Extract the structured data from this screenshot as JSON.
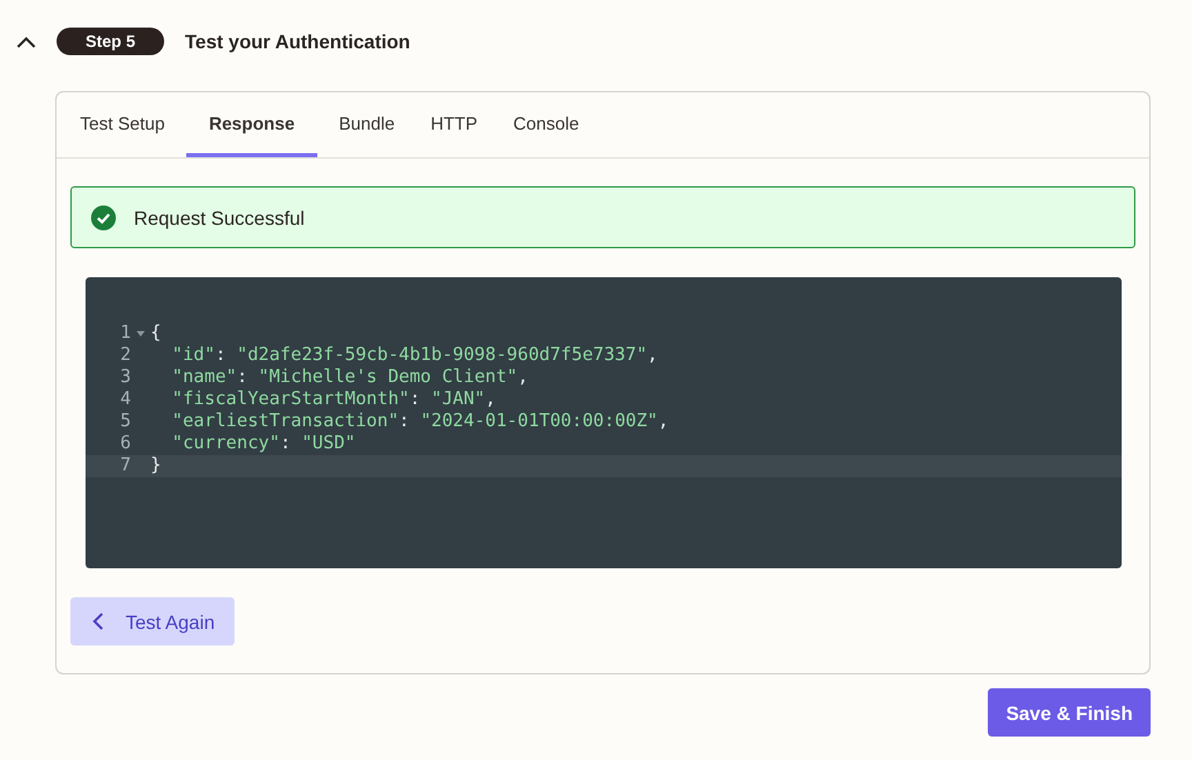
{
  "step": {
    "badge": "Step 5",
    "title": "Test your Authentication",
    "expanded": true
  },
  "tabs": [
    {
      "label": "Test Setup",
      "selected": false
    },
    {
      "label": "Response",
      "selected": true
    },
    {
      "label": "Bundle",
      "selected": false
    },
    {
      "label": "HTTP",
      "selected": false
    },
    {
      "label": "Console",
      "selected": false
    }
  ],
  "alert": {
    "kind": "success",
    "message": "Request Successful"
  },
  "code": {
    "lines": [
      {
        "number": "1",
        "text": "{",
        "foldable": true,
        "active": false
      },
      {
        "number": "2",
        "text": "  \"id\": \"d2afe23f-59cb-4b1b-9098-960d7f5e7337\",",
        "foldable": false,
        "active": false
      },
      {
        "number": "3",
        "text": "  \"name\": \"Michelle's Demo Client\",",
        "foldable": false,
        "active": false
      },
      {
        "number": "4",
        "text": "  \"fiscalYearStartMonth\": \"JAN\",",
        "foldable": false,
        "active": false
      },
      {
        "number": "5",
        "text": "  \"earliestTransaction\": \"2024-01-01T00:00:00Z\",",
        "foldable": false,
        "active": false
      },
      {
        "number": "6",
        "text": "  \"currency\": \"USD\"",
        "foldable": false,
        "active": false
      },
      {
        "number": "7",
        "text": "}",
        "foldable": false,
        "active": true
      }
    ]
  },
  "test_again_button": "Test Again",
  "save_button": "Save & Finish"
}
